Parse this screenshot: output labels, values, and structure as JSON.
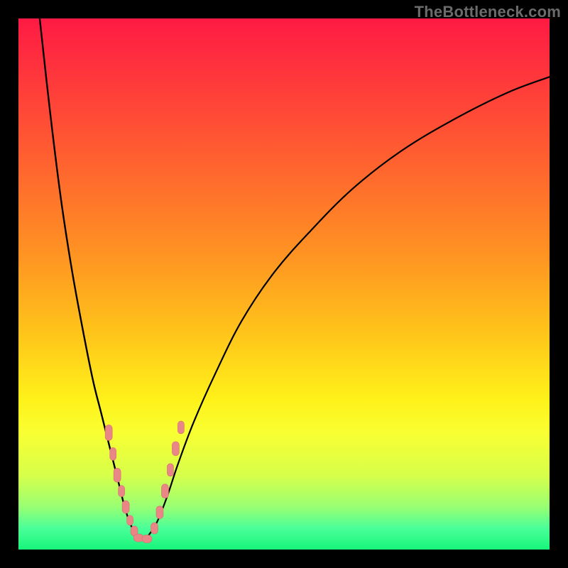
{
  "watermark": "TheBottleneck.com",
  "colors": {
    "background": "#000000",
    "gradient_top": "#ff1a44",
    "gradient_bottom": "#17f57a",
    "curve": "#000000",
    "marker": "#e98686"
  },
  "chart_data": {
    "type": "line",
    "title": "",
    "xlabel": "",
    "ylabel": "",
    "xlim": [
      0,
      100
    ],
    "ylim": [
      0,
      100
    ],
    "series": [
      {
        "name": "left-branch",
        "x": [
          4,
          6,
          8,
          10,
          12,
          14,
          15.5,
          17,
          18,
          19,
          20,
          21,
          22,
          23
        ],
        "y": [
          100,
          82,
          66,
          53,
          42,
          32,
          26,
          20,
          16,
          12,
          8,
          5,
          3,
          2
        ]
      },
      {
        "name": "right-branch",
        "x": [
          24,
          26,
          28,
          30,
          33,
          37,
          42,
          48,
          55,
          63,
          72,
          82,
          92,
          100
        ],
        "y": [
          2,
          5,
          10,
          16,
          24,
          33,
          43,
          52,
          60,
          68,
          75,
          81,
          86,
          89
        ]
      }
    ],
    "annotations": {
      "note": "V-shaped bottleneck curve over red-to-green vertical gradient; minimum between x≈22 and x≈25 near y≈2. Pink rounded markers cluster along both branches near bottom (roughly x 17–30, y 2–25)."
    },
    "markers": [
      {
        "branch": "left",
        "x": 17.0,
        "y": 22,
        "w": 10,
        "h": 22
      },
      {
        "branch": "left",
        "x": 17.8,
        "y": 18,
        "w": 9,
        "h": 18
      },
      {
        "branch": "left",
        "x": 18.6,
        "y": 14,
        "w": 10,
        "h": 20
      },
      {
        "branch": "left",
        "x": 19.4,
        "y": 11,
        "w": 9,
        "h": 16
      },
      {
        "branch": "left",
        "x": 20.2,
        "y": 8,
        "w": 10,
        "h": 18
      },
      {
        "branch": "left",
        "x": 21.0,
        "y": 5.5,
        "w": 9,
        "h": 14
      },
      {
        "branch": "left",
        "x": 21.8,
        "y": 3.5,
        "w": 10,
        "h": 14
      },
      {
        "branch": "flat",
        "x": 22.6,
        "y": 2.2,
        "w": 14,
        "h": 11
      },
      {
        "branch": "flat",
        "x": 24.2,
        "y": 2.0,
        "w": 14,
        "h": 11
      },
      {
        "branch": "right",
        "x": 25.6,
        "y": 4,
        "w": 10,
        "h": 16
      },
      {
        "branch": "right",
        "x": 26.6,
        "y": 7,
        "w": 10,
        "h": 18
      },
      {
        "branch": "right",
        "x": 27.6,
        "y": 11,
        "w": 10,
        "h": 20
      },
      {
        "branch": "right",
        "x": 28.6,
        "y": 15,
        "w": 9,
        "h": 18
      },
      {
        "branch": "right",
        "x": 29.6,
        "y": 19,
        "w": 10,
        "h": 20
      },
      {
        "branch": "right",
        "x": 30.6,
        "y": 23,
        "w": 9,
        "h": 18
      }
    ]
  }
}
